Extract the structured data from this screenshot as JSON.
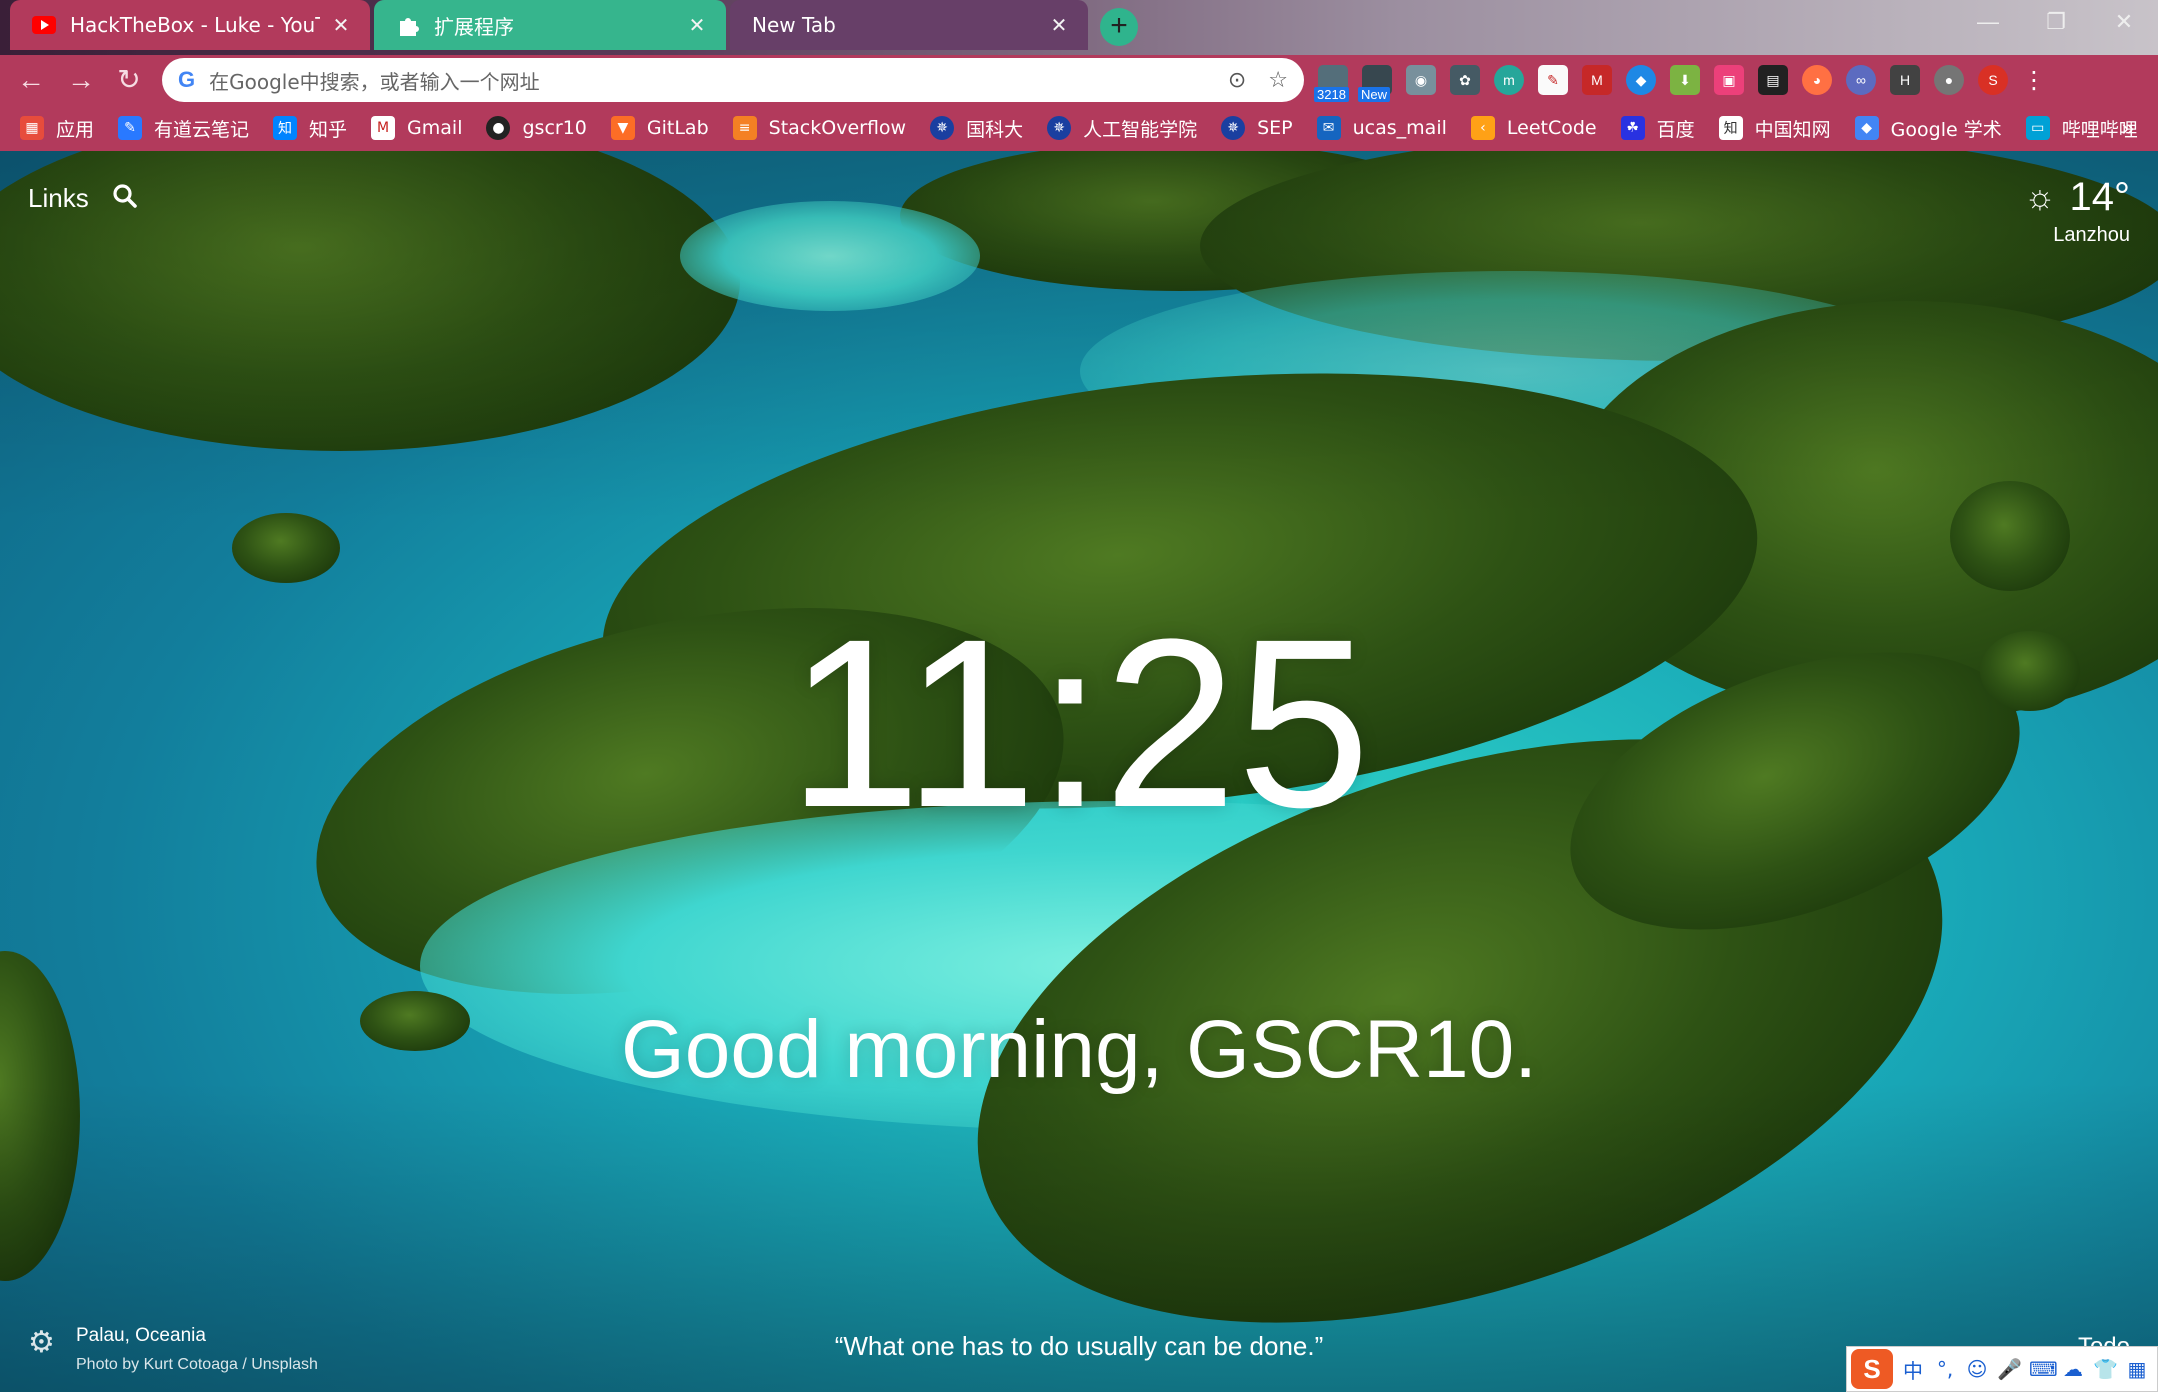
{
  "tabs": [
    {
      "title": "HackTheBox - Luke - YouTube",
      "close": "✕"
    },
    {
      "title": "扩展程序",
      "close": "✕"
    },
    {
      "title": "New Tab",
      "close": "✕"
    }
  ],
  "window_controls": {
    "minimize": "—",
    "maximize": "❐",
    "close": "✕"
  },
  "toolbar": {
    "back": "←",
    "forward": "→",
    "reload": "↻",
    "omnibox_placeholder": "在Google中搜索，或者输入一个网址",
    "ext_badges": {
      "count": "3218",
      "new": "New"
    },
    "profile_initial": "S",
    "menu": "⋮"
  },
  "bookmarks": [
    {
      "label": "应用",
      "color": "#e74c3c"
    },
    {
      "label": "有道云笔记",
      "color": "#2979ff"
    },
    {
      "label": "知乎",
      "color": "#0084ff"
    },
    {
      "label": "Gmail",
      "color": "#c5221f"
    },
    {
      "label": "gscr10",
      "color": "#222222"
    },
    {
      "label": "GitLab",
      "color": "#fc6d26"
    },
    {
      "label": "StackOverflow",
      "color": "#f48024"
    },
    {
      "label": "国科大",
      "color": "#1a3fa0"
    },
    {
      "label": "人工智能学院",
      "color": "#1a3fa0"
    },
    {
      "label": "SEP",
      "color": "#1a3fa0"
    },
    {
      "label": "ucas_mail",
      "color": "#1565c0"
    },
    {
      "label": "LeetCode",
      "color": "#ffa116"
    },
    {
      "label": "百度",
      "color": "#2932e1"
    },
    {
      "label": "中国知网",
      "color": "#333333"
    },
    {
      "label": "Google 学术",
      "color": "#4285f4"
    },
    {
      "label": "哔哩哔哩",
      "color": "#00a1d6"
    }
  ],
  "bookmarks_more": "»",
  "momentum": {
    "links_label": "Links",
    "weather": {
      "temp": "14°",
      "location": "Lanzhou"
    },
    "time": "11:25",
    "greeting": "Good morning, GSCR10.",
    "photo_location": "Palau, Oceania",
    "photo_credit": "Photo by Kurt Cotoaga / Unsplash",
    "quote": "“What one has to do usually can be done.”",
    "todo_label": "Todo"
  },
  "ime": {
    "logo": "S",
    "items": [
      "中",
      "°,",
      "☺",
      "🎤",
      "⌨",
      "☁",
      "👕",
      "▦"
    ]
  }
}
